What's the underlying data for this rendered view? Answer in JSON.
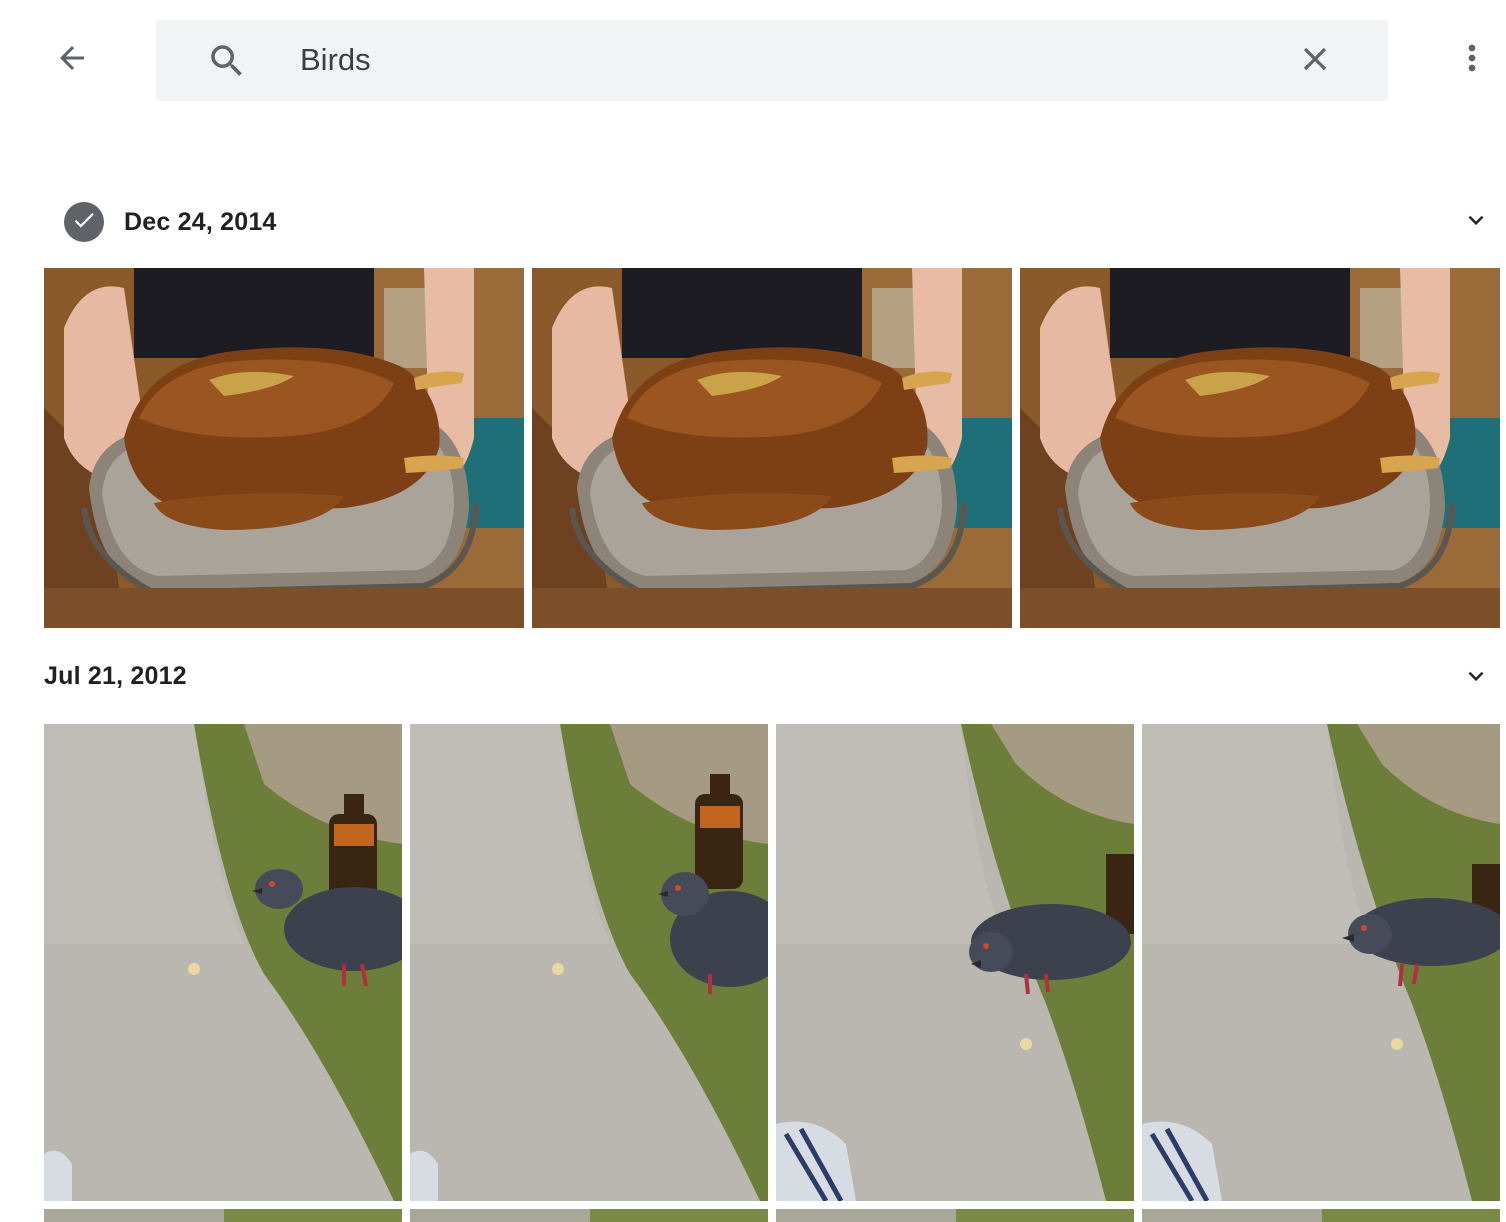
{
  "search": {
    "query": "Birds",
    "back_icon": "arrow-back-icon",
    "search_icon": "search-icon",
    "clear_icon": "close-icon",
    "more_icon": "more-vert-icon"
  },
  "sections": [
    {
      "date": "Dec 24, 2014",
      "selected": true,
      "photos": [
        {
          "subject": "roast-bird-on-silver-tray"
        },
        {
          "subject": "roast-bird-on-silver-tray"
        },
        {
          "subject": "roast-bird-on-silver-tray"
        }
      ]
    },
    {
      "date": "Jul 21, 2012",
      "selected": false,
      "photos": [
        {
          "subject": "pigeon-on-sidewalk"
        },
        {
          "subject": "pigeon-on-sidewalk"
        },
        {
          "subject": "pigeon-on-sidewalk"
        },
        {
          "subject": "pigeon-on-sidewalk"
        }
      ]
    }
  ],
  "colors": {
    "icon": "#5f6368",
    "search_bg": "#f1f3f4",
    "text": "#202124"
  }
}
